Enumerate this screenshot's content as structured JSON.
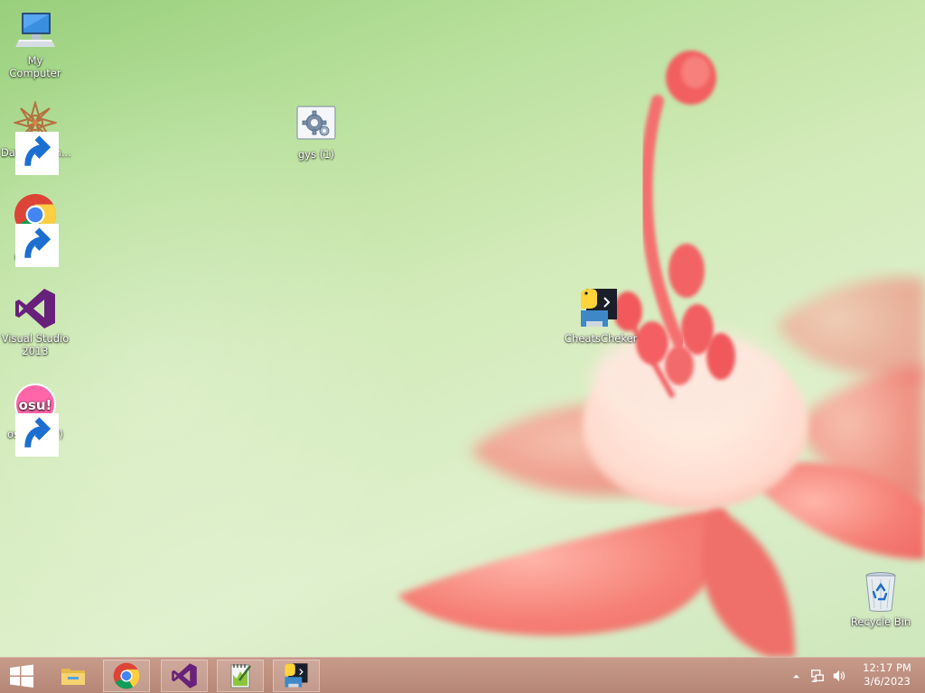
{
  "desktop_icons": [
    {
      "id": "my-computer",
      "label": "My Computer"
    },
    {
      "id": "datawagon",
      "label": "DataWagon..."
    },
    {
      "id": "google-chrome",
      "label": "Google Chrome"
    },
    {
      "id": "visual-studio",
      "label": "Visual Studio 2013"
    },
    {
      "id": "osu",
      "label": "osu!(lazer)",
      "logo_text": "osu!"
    },
    {
      "id": "gys",
      "label": "gys (1)"
    },
    {
      "id": "cheatchecker",
      "label": "CheatsCheker"
    },
    {
      "id": "recycle-bin",
      "label": "Recycle Bin"
    }
  ],
  "taskbar": {
    "start_icon": "windows-logo-icon",
    "pinned": [
      {
        "name": "file-explorer",
        "icon": "folder-icon"
      },
      {
        "name": "chrome",
        "icon": "chrome-icon",
        "open": true
      },
      {
        "name": "visual-studio",
        "icon": "visual-studio-icon",
        "open": true
      },
      {
        "name": "notepad-plus-plus",
        "icon": "notepad-icon",
        "open": true
      },
      {
        "name": "cheatchecker",
        "icon": "python-console-icon",
        "open": true
      }
    ],
    "tray": {
      "time": "12:17 PM",
      "date": "3/6/2023"
    }
  },
  "colors": {
    "taskbar": "#b88a7a",
    "wallpaper_green": "#c8e6b0",
    "flower_pink": "#f27d78"
  }
}
